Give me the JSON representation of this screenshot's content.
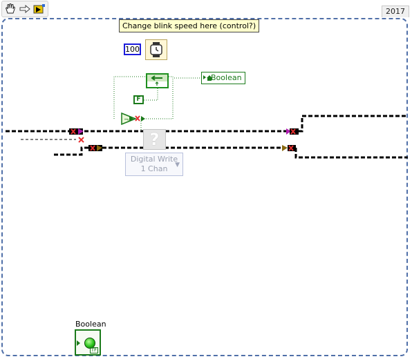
{
  "toolbar": {
    "buttons": [
      {
        "icon": "highlight-execution-icon"
      },
      {
        "icon": "retain-wire-values-icon"
      },
      {
        "icon": "step-into-icon"
      }
    ]
  },
  "frame": {
    "year_label": "2017"
  },
  "comment": {
    "text": "Change blink speed here (control?)"
  },
  "constants": {
    "wait_ms": "100",
    "false_const": "F"
  },
  "local_variable": {
    "label": "Boolean"
  },
  "missing_vi": {
    "name_line1": "Digital Write",
    "name_line2": "1 Chan"
  },
  "indicator": {
    "label": "Boolean",
    "tf": "TF"
  },
  "colors": {
    "bool_wire": "#1a7a1a",
    "error_wire": "#000000",
    "int_const": "#1b1bdc"
  }
}
